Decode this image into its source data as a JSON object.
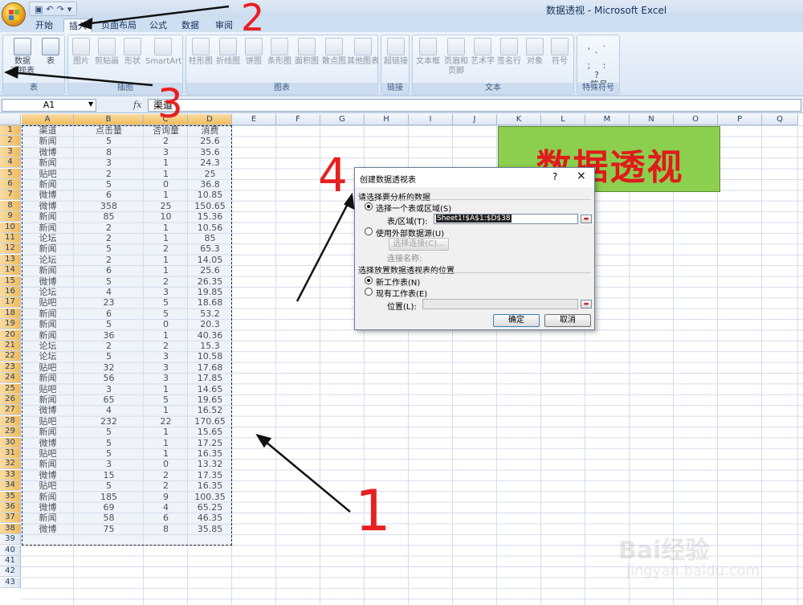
{
  "window": {
    "title": "数据透视 - Microsoft Excel"
  },
  "tabs": [
    "开始",
    "插入",
    "页面布局",
    "公式",
    "数据",
    "审阅"
  ],
  "active_tab": "插入",
  "ribbon": {
    "groups": [
      {
        "label": "表",
        "buttons": [
          "数据透视表",
          "表"
        ]
      },
      {
        "label": "插图",
        "buttons": [
          "图片",
          "剪贴画",
          "形状",
          "SmartArt"
        ]
      },
      {
        "label": "图表",
        "buttons": [
          "柱形图",
          "折线图",
          "饼图",
          "条形图",
          "面积图",
          "散点图",
          "其他图表"
        ]
      },
      {
        "label": "链接",
        "buttons": [
          "超链接"
        ]
      },
      {
        "label": "文本",
        "buttons": [
          "文本框",
          "页眉和页脚",
          "艺术字",
          "签名行",
          "对象",
          "符号"
        ]
      },
      {
        "label": "特殊符号",
        "buttons": [
          "符号"
        ]
      }
    ],
    "pivot_label_1": "数据",
    "pivot_label_2": "透视表",
    "header_footer_1": "页眉和",
    "header_footer_2": "页脚"
  },
  "formula_bar": {
    "name_box": "A1",
    "fx": "fx",
    "value": "渠道"
  },
  "columns": [
    "A",
    "B",
    "C",
    "D",
    "E",
    "F",
    "G",
    "H",
    "I",
    "J",
    "K",
    "L",
    "M",
    "N",
    "O",
    "P",
    "Q"
  ],
  "rows_count": 43,
  "table": {
    "headers": [
      "渠道",
      "点击量",
      "咨询量",
      "消费"
    ],
    "rows": [
      [
        "新闻",
        "5",
        "2",
        "25.6"
      ],
      [
        "微博",
        "8",
        "3",
        "35.6"
      ],
      [
        "新闻",
        "3",
        "1",
        "24.3"
      ],
      [
        "贴吧",
        "2",
        "1",
        "25"
      ],
      [
        "新闻",
        "5",
        "0",
        "36.8"
      ],
      [
        "微博",
        "6",
        "1",
        "10.85"
      ],
      [
        "微博",
        "358",
        "25",
        "150.65"
      ],
      [
        "新闻",
        "85",
        "10",
        "15.36"
      ],
      [
        "新闻",
        "2",
        "1",
        "10.56"
      ],
      [
        "论坛",
        "2",
        "1",
        "85"
      ],
      [
        "新闻",
        "5",
        "2",
        "65.3"
      ],
      [
        "论坛",
        "2",
        "1",
        "14.05"
      ],
      [
        "新闻",
        "6",
        "1",
        "25.6"
      ],
      [
        "微博",
        "5",
        "2",
        "26.35"
      ],
      [
        "论坛",
        "4",
        "3",
        "19.85"
      ],
      [
        "贴吧",
        "23",
        "5",
        "18.68"
      ],
      [
        "新闻",
        "6",
        "5",
        "53.2"
      ],
      [
        "新闻",
        "5",
        "0",
        "20.3"
      ],
      [
        "新闻",
        "36",
        "1",
        "40.36"
      ],
      [
        "论坛",
        "2",
        "2",
        "15.3"
      ],
      [
        "论坛",
        "5",
        "3",
        "10.58"
      ],
      [
        "贴吧",
        "32",
        "3",
        "17.68"
      ],
      [
        "新闻",
        "56",
        "3",
        "17.85"
      ],
      [
        "贴吧",
        "3",
        "1",
        "14.65"
      ],
      [
        "新闻",
        "65",
        "5",
        "19.65"
      ],
      [
        "微博",
        "4",
        "1",
        "16.52"
      ],
      [
        "贴吧",
        "232",
        "22",
        "170.65"
      ],
      [
        "新闻",
        "5",
        "1",
        "15.65"
      ],
      [
        "微博",
        "5",
        "1",
        "17.25"
      ],
      [
        "贴吧",
        "5",
        "1",
        "16.35"
      ],
      [
        "新闻",
        "3",
        "0",
        "13.32"
      ],
      [
        "微博",
        "15",
        "2",
        "17.35"
      ],
      [
        "贴吧",
        "5",
        "2",
        "16.35"
      ],
      [
        "新闻",
        "185",
        "9",
        "100.35"
      ],
      [
        "微博",
        "69",
        "4",
        "65.25"
      ],
      [
        "新闻",
        "58",
        "6",
        "46.35"
      ],
      [
        "微博",
        "75",
        "8",
        "35.85"
      ]
    ]
  },
  "banner": {
    "text": "数据透视",
    "bg": "#8ccf4f",
    "color": "#e01b1b"
  },
  "dialog": {
    "title": "创建数据透视表",
    "help": "?",
    "close": "×",
    "section1": "请选择要分析的数据",
    "opt_range": "选择一个表或区域(S)",
    "range_label": "表/区域(T):",
    "range_value": "Sheet1!$A$1:$D$38",
    "opt_external": "使用外部数据源(U)",
    "choose_conn": "选择连接(C)...",
    "conn_name": "连接名称:",
    "section2": "选择放置数据透视表的位置",
    "opt_new_sheet": "新工作表(N)",
    "opt_existing": "现有工作表(E)",
    "location_label": "位置(L):",
    "ok": "确定",
    "cancel": "取消"
  },
  "annotations": {
    "n1": "1",
    "n2": "2",
    "n3": "3",
    "n4": "4",
    "color": "#e82020"
  },
  "watermark": {
    "main": "Bai经验",
    "sub": "jingyan.baidu.com"
  }
}
